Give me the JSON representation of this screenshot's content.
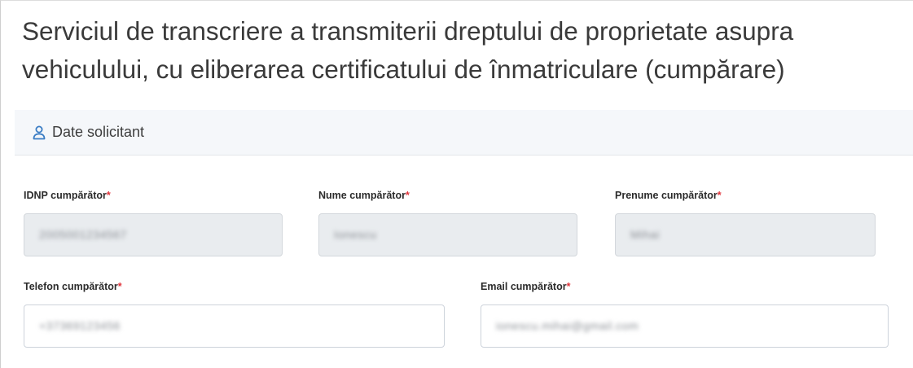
{
  "page": {
    "title": "Serviciul de transcriere a transmiterii dreptului de proprietate asupra vehiculului, cu eliberarea certificatului de înmatriculare (cumpărare)"
  },
  "section": {
    "title": "Date solicitant",
    "icon": "user-icon"
  },
  "required_marker": "*",
  "fields": {
    "idnp": {
      "label": "IDNP cumpărător",
      "value": "2005001234567",
      "readonly": true
    },
    "nume": {
      "label": "Nume cumpărător",
      "value": "Ionescu",
      "readonly": true
    },
    "prenume": {
      "label": "Prenume cumpărător",
      "value": "Mihai",
      "readonly": true
    },
    "telefon": {
      "label": "Telefon cumpărător",
      "value": "+37369123456",
      "readonly": false
    },
    "email": {
      "label": "Email cumpărător",
      "value": "ionescu.mihai@gmail.com",
      "readonly": false
    }
  },
  "colors": {
    "required": "#e0333a",
    "icon": "#3b7dc4",
    "header_bg": "#f5f7fa",
    "readonly_bg": "#e9ecef"
  }
}
